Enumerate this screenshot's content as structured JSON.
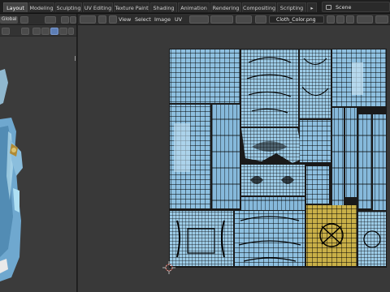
{
  "workspace_tabs": [
    "Layout",
    "Modeling",
    "Sculpting",
    "UV Editing",
    "Texture Paint",
    "Shading",
    "Animation",
    "Rendering",
    "Compositing",
    "Scripting"
  ],
  "active_workspace": "Layout",
  "scene_name": "Scene",
  "viewport": {
    "orientation": "Global"
  },
  "uv_editor": {
    "menus": [
      "View",
      "Select",
      "Image",
      "UV"
    ],
    "image_name": "Cloth_Color.png"
  },
  "colors": {
    "accent_selected": "#5d7eb5",
    "texture_blue": "#8fc0e0",
    "texture_yellow": "#c8b04a",
    "uv_wire": "#000000"
  },
  "icons": [
    "scene-icon",
    "image-icon",
    "cursor-icon",
    "uv-select-icon",
    "sync-icon"
  ]
}
